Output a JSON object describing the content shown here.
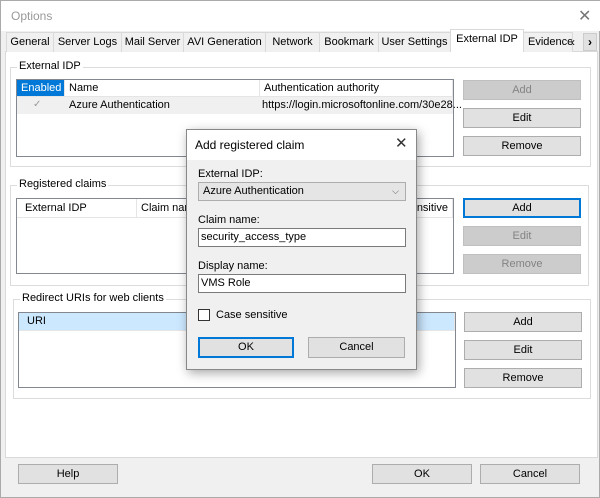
{
  "window": {
    "title": "Options",
    "close_icon": "close-icon"
  },
  "tabs": [
    "General",
    "Server Logs",
    "Mail Server",
    "AVI Generation",
    "Network",
    "Bookmark",
    "User Settings",
    "External IDP",
    "Evidence"
  ],
  "selected_tab": "External IDP",
  "external_idp": {
    "label": "External IDP",
    "columns": [
      "Enabled",
      "Name",
      "Authentication authority"
    ],
    "rows": [
      {
        "enabled": true,
        "name": "Azure Authentication",
        "authority": "https://login.microsoftonline.com/30e28..."
      }
    ],
    "buttons": {
      "add": "Add",
      "edit": "Edit",
      "remove": "Remove"
    }
  },
  "registered_claims": {
    "label": "Registered claims",
    "columns": [
      "External IDP",
      "Claim nam",
      "nsitive"
    ],
    "buttons": {
      "add": "Add",
      "edit": "Edit",
      "remove": "Remove"
    }
  },
  "redirect_uris": {
    "label": "Redirect URIs for web clients",
    "columns": [
      "URI"
    ],
    "buttons": {
      "add": "Add",
      "edit": "Edit",
      "remove": "Remove"
    }
  },
  "footer": {
    "help": "Help",
    "ok": "OK",
    "cancel": "Cancel"
  },
  "dialog": {
    "title": "Add registered claim",
    "external_idp_label": "External IDP:",
    "external_idp_value": "Azure Authentication",
    "claim_name_label": "Claim name:",
    "claim_name_value": "security_access_type",
    "display_name_label": "Display name:",
    "display_name_value": "VMS Role",
    "case_sensitive_label": "Case sensitive",
    "case_sensitive_checked": false,
    "ok": "OK",
    "cancel": "Cancel"
  },
  "colors": {
    "accent": "#0078d7",
    "selected_header": "#cce8ff"
  }
}
